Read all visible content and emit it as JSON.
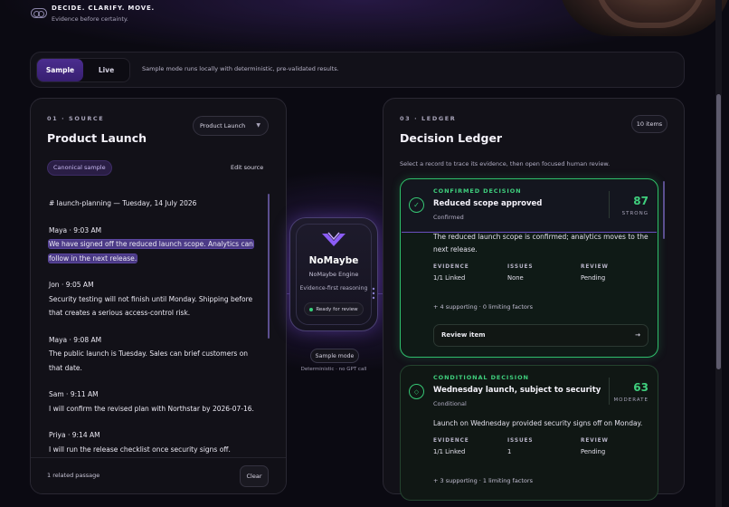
{
  "header": {
    "tagline": "DECIDE. CLARIFY. MOVE.",
    "subtitle": "Evidence before certainty."
  },
  "mode": {
    "options": [
      "Sample",
      "Live"
    ],
    "selected": "Sample",
    "note": "Sample mode runs locally with deterministic, pre-validated results."
  },
  "source": {
    "eyebrow": "01 · SOURCE",
    "title": "Product Launch",
    "dropdown_value": "Product Launch",
    "pill": "Canonical sample",
    "edit_label": "Edit source",
    "heading": "# launch-planning — Tuesday, 14 July 2026",
    "messages": [
      {
        "author": "Maya · 9:03 AM",
        "lines": [
          "We have signed off the reduced launch scope. Analytics can",
          "follow in the next release."
        ],
        "highlighted": true
      },
      {
        "author": "Jon · 9:05 AM",
        "lines": [
          "Security testing will not finish until Monday. Shipping before",
          "that creates a serious access-control risk."
        ],
        "highlighted": false
      },
      {
        "author": "Maya · 9:08 AM",
        "lines": [
          "The public launch is Tuesday. Sales can brief customers on",
          "that date."
        ],
        "highlighted": false
      },
      {
        "author": "Sam · 9:11 AM",
        "lines": [
          "I will confirm the revised plan with Northstar by 2026-07-16."
        ],
        "highlighted": false
      },
      {
        "author": "Priya · 9:14 AM",
        "lines": [
          "I will run the release checklist once security signs off."
        ],
        "highlighted": false
      }
    ],
    "related": "1 related passage",
    "clear_label": "Clear"
  },
  "engine": {
    "name": "NoMaybe",
    "subtitle": "NoMaybe Engine",
    "tagline": "Evidence-first reasoning",
    "status": "Ready for review",
    "mode_pill": "Sample mode",
    "mode_note": "Deterministic · no GPT call",
    "colors": {
      "accent": "#8b5cf6",
      "ready": "#37d07a"
    }
  },
  "ledger": {
    "eyebrow": "03 · LEDGER",
    "title": "Decision Ledger",
    "count": "10 items",
    "hint": "Select a record to trace its evidence, then open focused human review.",
    "meta_headers": [
      "EVIDENCE",
      "ISSUES",
      "REVIEW"
    ],
    "cards": [
      {
        "tag": "CONFIRMED DECISION",
        "title": "Reduced scope approved",
        "status": "Confirmed",
        "score": "87",
        "score_label": "STRONG",
        "body": [
          "The reduced launch scope is confirmed; analytics moves to the",
          "next release."
        ],
        "evidence": "1/1 Linked",
        "issues": "None",
        "review": "Pending",
        "factors": "+ 4 supporting · 0 limiting factors",
        "action": "Review item",
        "icon": "check-icon"
      },
      {
        "tag": "CONDITIONAL DECISION",
        "title": "Wednesday launch, subject to security",
        "status": "Conditional",
        "score": "63",
        "score_label": "MODERATE",
        "body": [
          "Launch on Wednesday provided security signs off on Monday."
        ],
        "evidence": "1/1 Linked",
        "issues": "1",
        "review": "Pending",
        "factors": "+ 3 supporting · 1 limiting factors",
        "icon": "diamond-icon"
      }
    ],
    "colors": {
      "confirmed": "#3fcf7d",
      "highlight": "#4b3a86"
    }
  }
}
